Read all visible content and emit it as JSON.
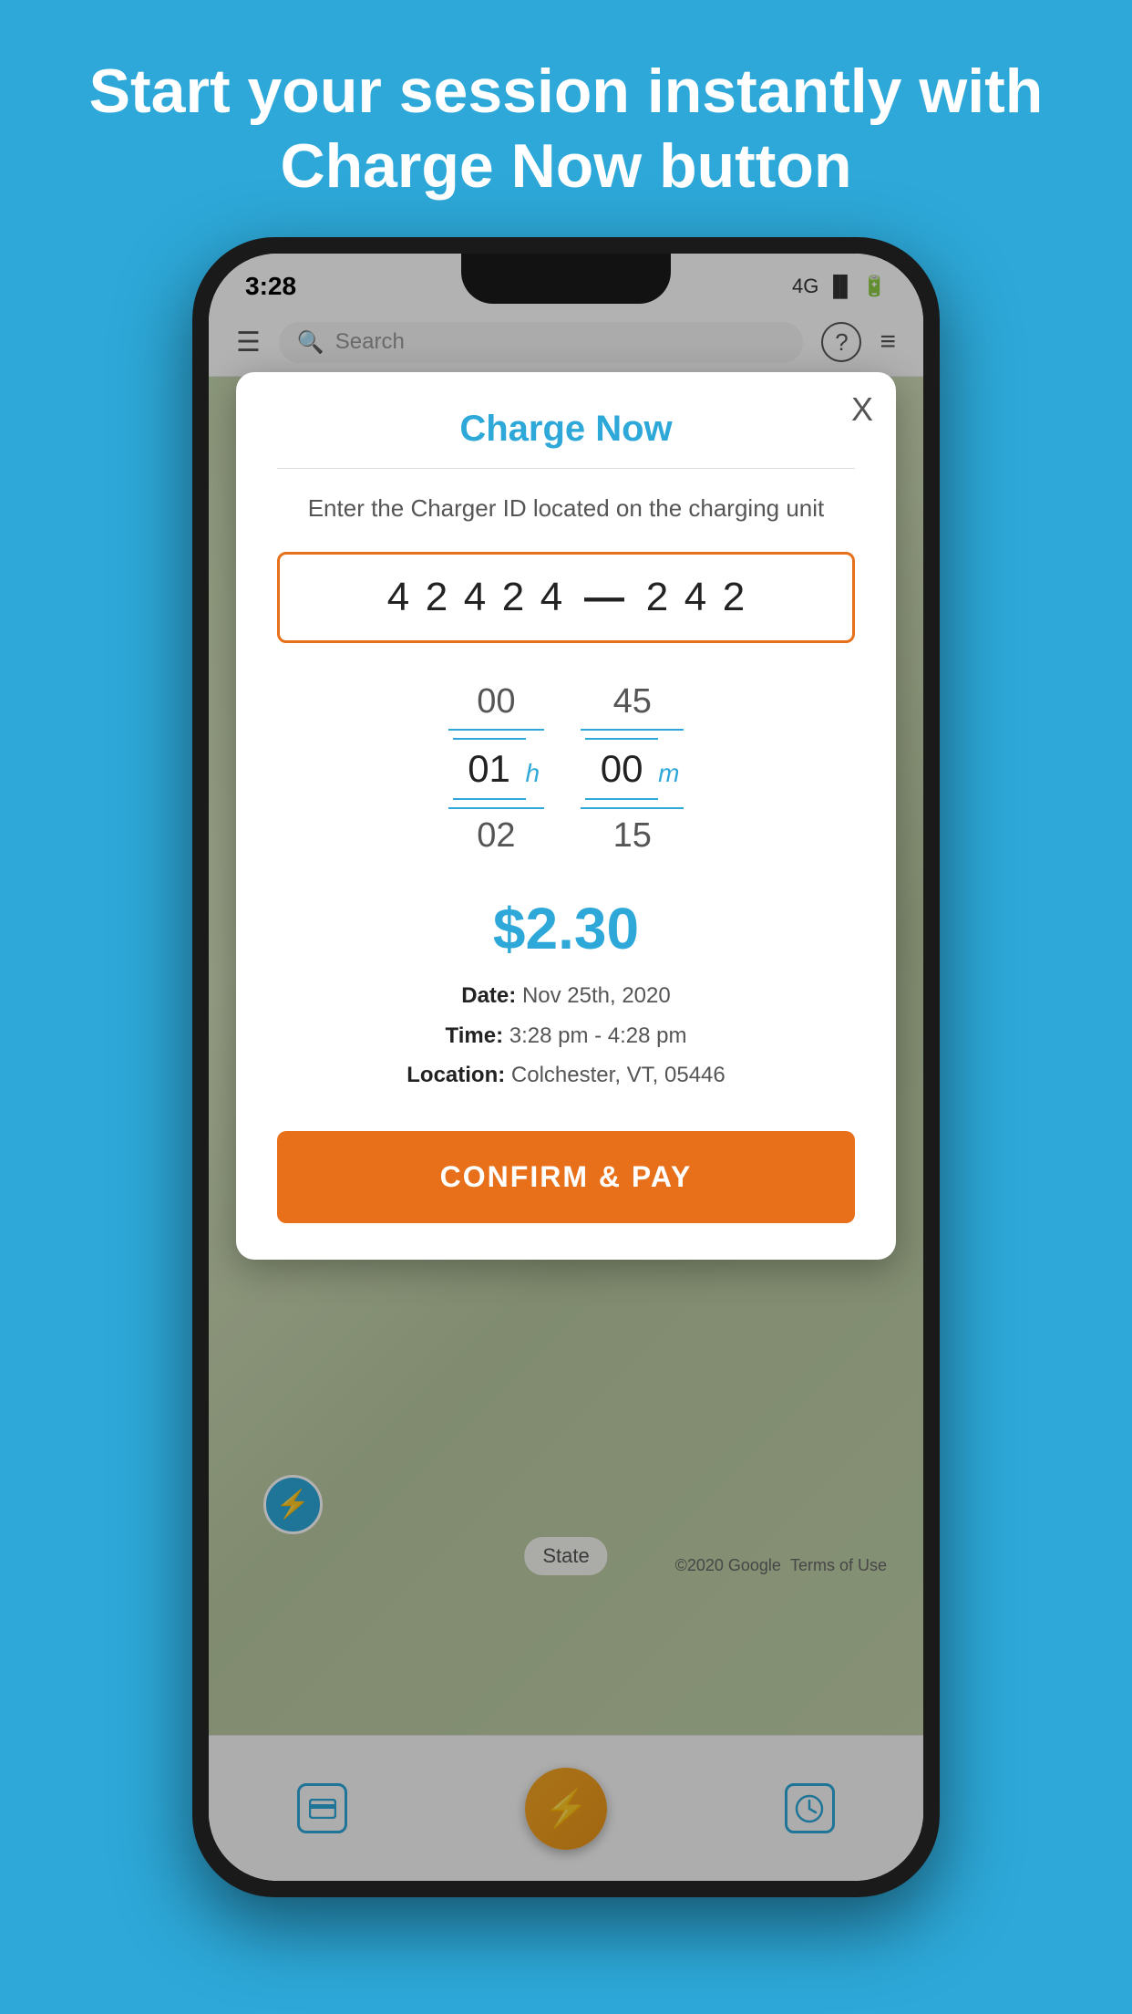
{
  "page": {
    "background_color": "#2da8d8",
    "header_text": "Start your session instantly with Charge Now button"
  },
  "status_bar": {
    "time": "3:28",
    "network": "4G",
    "battery": "▓"
  },
  "app_bar": {
    "search_placeholder": "Search",
    "menu_icon": "☰",
    "search_icon": "🔍",
    "help_icon": "?",
    "filter_icon": "≡"
  },
  "modal": {
    "title": "Charge Now",
    "close_label": "X",
    "subtitle": "Enter the Charger ID located on the charging unit",
    "charger_id": {
      "part1": [
        "4",
        "2",
        "4",
        "2",
        "4"
      ],
      "dash": "—",
      "part2": [
        "2",
        "4",
        "2"
      ]
    },
    "time_picker": {
      "left_values": [
        "00",
        "01",
        "02"
      ],
      "right_values": [
        "45",
        "00",
        "15"
      ],
      "left_unit": "h",
      "right_unit": "m"
    },
    "price": "$2.30",
    "session_info": {
      "date_label": "Date:",
      "date_value": "Nov 25th, 2020",
      "time_label": "Time:",
      "time_value": "3:28 pm - 4:28 pm",
      "location_label": "Location:",
      "location_value": "Colchester, VT, 05446"
    },
    "confirm_button_label": "CONFIRM & PAY"
  },
  "bottom_nav": {
    "items": [
      {
        "icon": "💳",
        "label": ""
      },
      {
        "icon": "⚡",
        "label": ""
      },
      {
        "icon": "🕐",
        "label": ""
      }
    ]
  },
  "android_nav": {
    "items": [
      "|||",
      "○",
      "<"
    ]
  },
  "map": {
    "state_label": "State",
    "google_label": "©2020 Google",
    "terms_label": "Terms of Use"
  }
}
